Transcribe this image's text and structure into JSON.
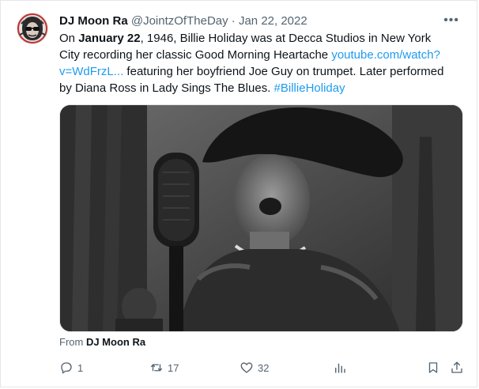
{
  "author": {
    "display_name": "DJ Moon Ra",
    "handle": "@JointzOfTheDay",
    "separator": "·",
    "date": "Jan 22, 2022"
  },
  "more_label": "•••",
  "text": {
    "p1": "On ",
    "date_bold": "January 22",
    "p2": ", 1946, Billie Holiday was at Decca Studios in New York City recording her classic Good Morning Heartache ",
    "link": "youtube.com/watch?v=WdFrzL...",
    "p3": " featuring her boyfriend Joe Guy on trumpet. Later performed by Diana Ross in Lady Sings The Blues. ",
    "hashtag": "#BillieHoliday"
  },
  "from": {
    "prefix": "From ",
    "name": "DJ Moon Ra"
  },
  "actions": {
    "reply_count": "1",
    "retweet_count": "17",
    "like_count": "32"
  },
  "colors": {
    "link": "#1d9bf0",
    "secondary": "#536471",
    "primary": "#0f1419"
  }
}
